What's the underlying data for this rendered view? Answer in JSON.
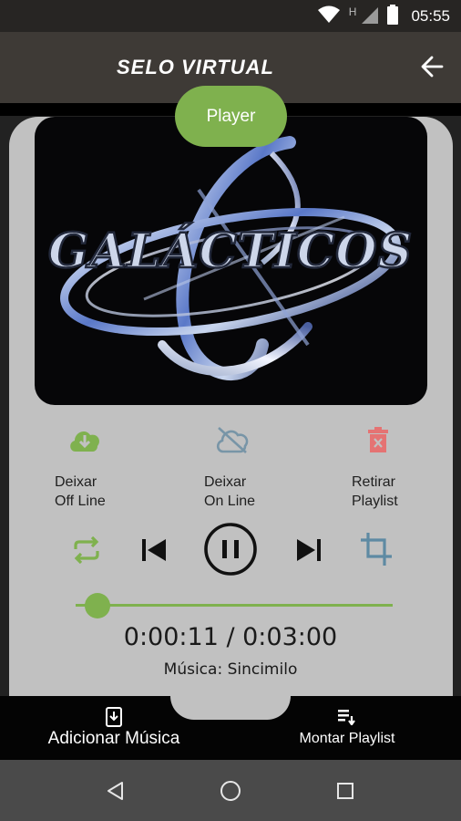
{
  "status_bar": {
    "time": "05:55",
    "network_letter": "H",
    "icons": [
      "wifi-icon",
      "signal-icon",
      "battery-icon"
    ]
  },
  "app_bar": {
    "title": "SELO VIRTUAL",
    "back_icon": "arrow-back-icon"
  },
  "player_tab": {
    "label": "Player"
  },
  "cover": {
    "art_text": "GALÁCTICOS"
  },
  "actions": [
    {
      "label_line1": "Deixar",
      "label_line2": "Off Line",
      "icon": "cloud-download-icon",
      "color": "#7fb14e"
    },
    {
      "label_line1": "Deixar",
      "label_line2": "On Line",
      "icon": "cloud-off-icon",
      "color": "#7895a7"
    },
    {
      "label_line1": "Retirar",
      "label_line2": "Playlist",
      "icon": "trash-icon",
      "color": "#e57373"
    }
  ],
  "controls": {
    "repeat_icon": "repeat-icon",
    "prev_icon": "skip-previous-icon",
    "pause_icon": "pause-icon",
    "next_icon": "skip-next-icon",
    "crop_icon": "crop-icon"
  },
  "progress": {
    "fraction": 0.06
  },
  "time_display": "0:00:11 / 0:03:00",
  "song_display": "Música: Sincimilo",
  "bottom_nav": [
    {
      "label": "Adicionar Música",
      "icon": "add-music-icon"
    },
    {
      "label": "Montar Playlist",
      "icon": "playlist-add-icon"
    }
  ],
  "system_nav": [
    "back-triangle-icon",
    "home-circle-icon",
    "recents-square-icon"
  ],
  "colors": {
    "accent": "#7fb14e",
    "card": "#c1c1c1",
    "app_bar": "#3e3a36",
    "danger": "#e57373",
    "muted_blue": "#7895a7"
  }
}
